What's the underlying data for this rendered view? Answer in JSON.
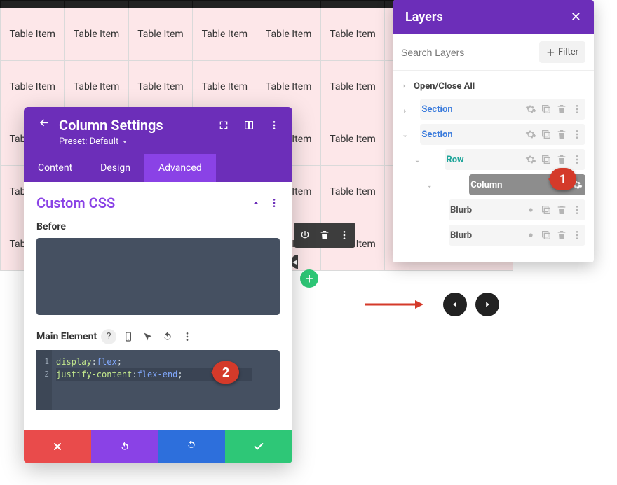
{
  "table": {
    "cell_label": "Table Item"
  },
  "modal": {
    "title": "Column Settings",
    "preset": "Preset: Default",
    "tabs": {
      "content": "Content",
      "design": "Design",
      "advanced": "Advanced"
    },
    "section_title": "Custom CSS",
    "before_label": "Before",
    "main_label": "Main Element",
    "code": {
      "l1_prop": "display",
      "l1_val": "flex",
      "l2_prop": "justify-content",
      "l2_val": "flex-end"
    }
  },
  "layers": {
    "title": "Layers",
    "search_placeholder": "Search Layers",
    "filter": "Filter",
    "open_close": "Open/Close All",
    "items": {
      "section": "Section",
      "row": "Row",
      "column": "Column",
      "blurb": "Blurb"
    }
  },
  "badges": {
    "one": "1",
    "two": "2"
  },
  "chart_data": {
    "type": "table",
    "columns": 7,
    "rows": 5,
    "cell_value": "Table Item",
    "note": "Uniform placeholder table grid; no numeric data."
  }
}
